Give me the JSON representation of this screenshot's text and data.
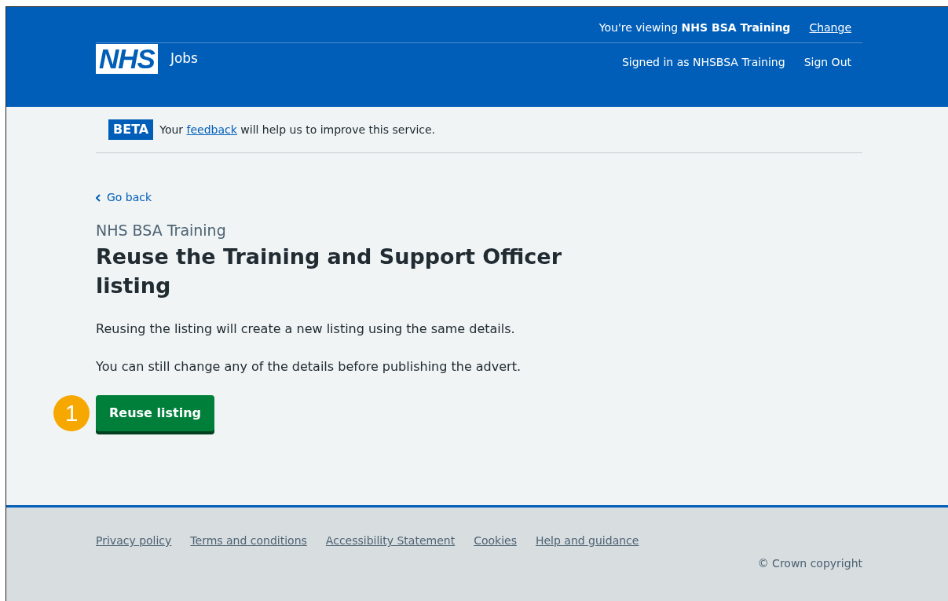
{
  "header": {
    "logo": "NHS",
    "service": "Jobs",
    "viewing": "You're viewing **NHS BSA Training**",
    "change_link": "Change",
    "signed_in": "Signed in as NHSBSA Training",
    "sign_out": "Sign Out"
  },
  "phase_banner": {
    "tag": "BETA",
    "text_before": "Your",
    "link": "feedback",
    "text_after": "will help us to improve this service."
  },
  "back_link": "Go back",
  "caption": "NHS BSA Training",
  "heading": "Reuse the Training and Support Officer listing",
  "paragraphs": [
    "Reusing the listing will create a new listing using the same details.",
    "You can still change any of the details before publishing the advert."
  ],
  "step_marker": "1",
  "button": "Reuse listing",
  "footer": {
    "links": [
      "Privacy policy",
      "Terms and conditions",
      "Accessibility Statement",
      "Cookies",
      "Help and guidance"
    ],
    "copyright": "© Crown copyright"
  }
}
